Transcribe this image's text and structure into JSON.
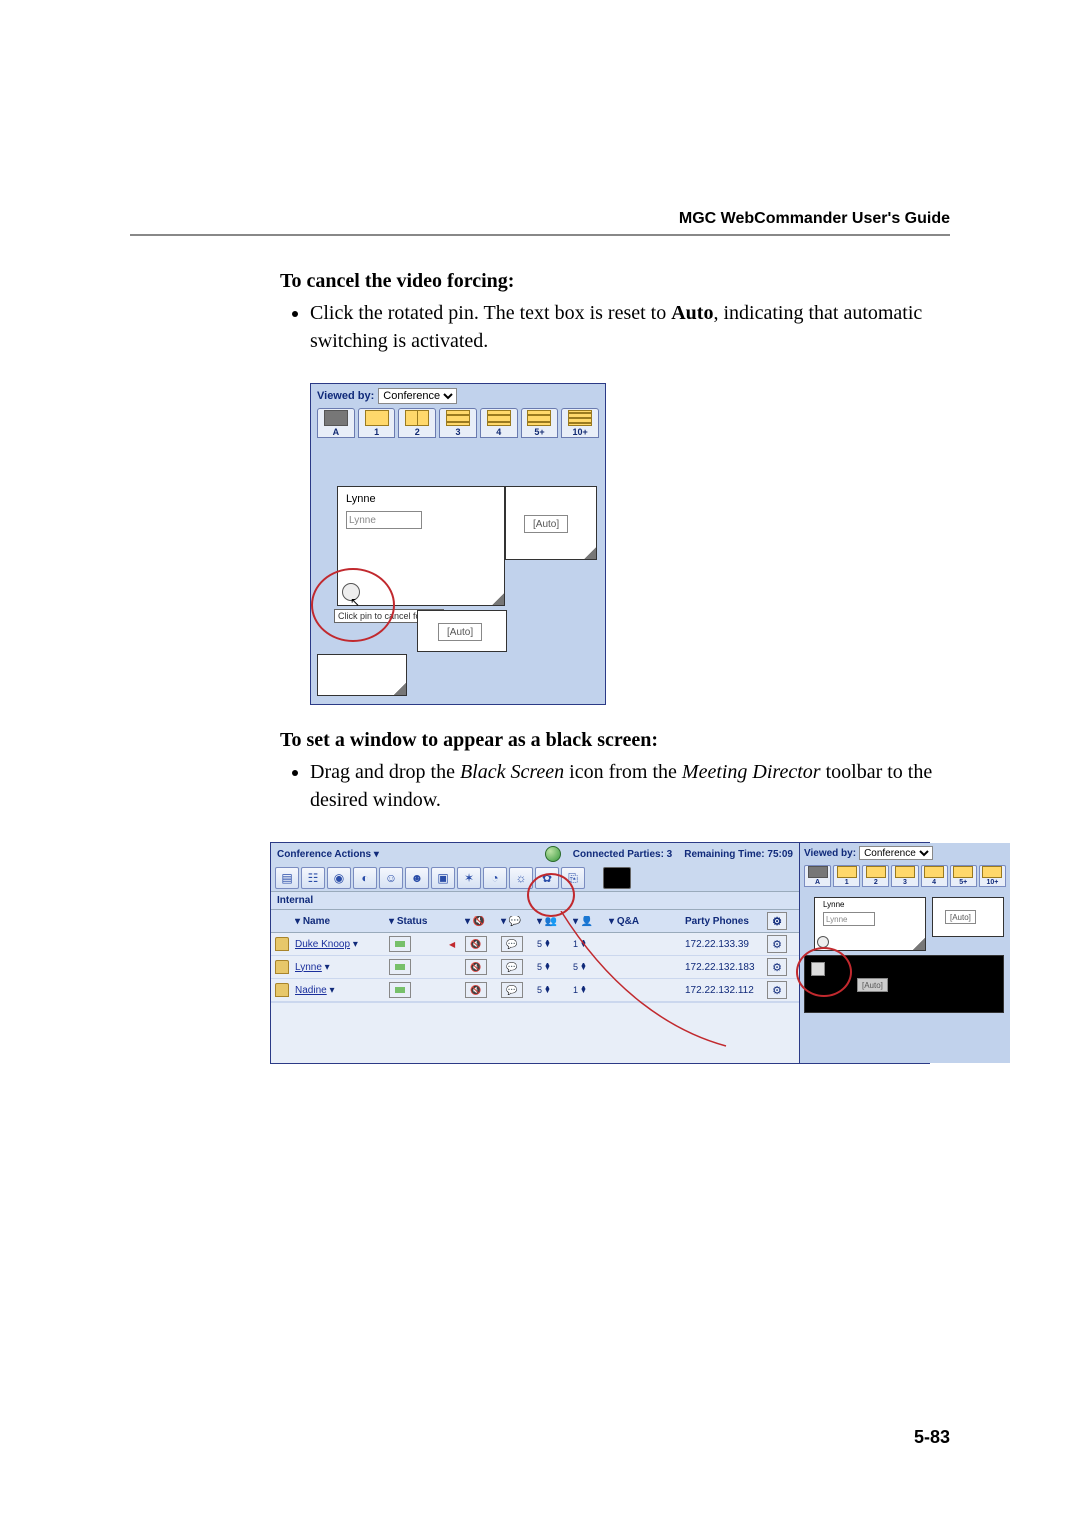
{
  "header": {
    "title": "MGC WebCommander User's Guide"
  },
  "section1": {
    "heading": "To cancel the video forcing:",
    "bullet_pre": "Click the rotated pin. The text box is reset to ",
    "bullet_bold": "Auto",
    "bullet_post": ", indicating that automatic switching is activated."
  },
  "panel1": {
    "viewed_by_label": "Viewed by:",
    "viewed_by_value": "Conference",
    "tabs": [
      "A",
      "1",
      "2",
      "3",
      "4",
      "5+",
      "10+"
    ],
    "cell_lynne_title": "Lynne",
    "cell_lynne_input": "Lynne",
    "auto_label": "[Auto]",
    "tooltip": "Click pin to cancel forcing"
  },
  "section2": {
    "heading": "To set a window to appear as a black screen:",
    "bullet_pre": "Drag and drop the ",
    "bullet_em1": "Black Screen",
    "bullet_mid": " icon from the ",
    "bullet_em2": "Meeting Director",
    "bullet_post": " toolbar to the desired window."
  },
  "meeting": {
    "actions_label": "Conference Actions",
    "connected_label": "Connected Parties: 3",
    "remaining_label": "Remaining Time: 75:09",
    "tab_internal": "Internal",
    "columns": {
      "name": "Name",
      "status": "Status",
      "qa": "Q&A",
      "phones": "Party Phones"
    },
    "rows": [
      {
        "name": "Duke Knoop",
        "has_red": true,
        "a": "5",
        "b": "1",
        "phone": "172.22.133.39"
      },
      {
        "name": "Lynne",
        "has_red": false,
        "a": "5",
        "b": "5",
        "phone": "172.22.132.183"
      },
      {
        "name": "Nadine",
        "has_red": false,
        "a": "5",
        "b": "1",
        "phone": "172.22.132.112"
      }
    ],
    "right": {
      "viewed_by_label": "Viewed by:",
      "viewed_by_value": "Conference",
      "tabs": [
        "A",
        "1",
        "2",
        "3",
        "4",
        "5+",
        "10+"
      ],
      "lynne": "Lynne",
      "lynne_sub": "Lynne",
      "auto": "[Auto]"
    }
  },
  "page_number": "5-83"
}
